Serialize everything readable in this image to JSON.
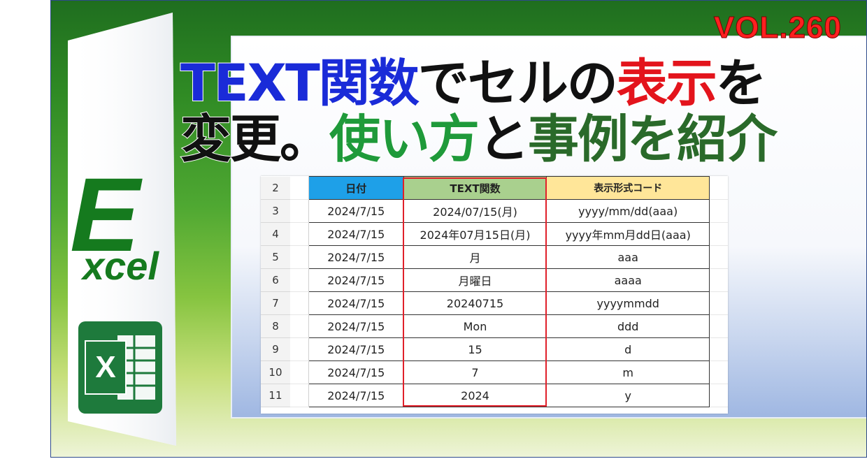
{
  "volume": "VOL.260",
  "title": {
    "line1": [
      {
        "text": "TEXT関数",
        "color": "blue"
      },
      {
        "text": "でセルの",
        "color": "black"
      },
      {
        "text": "表示",
        "color": "red"
      },
      {
        "text": "を",
        "color": "black"
      }
    ],
    "line2": [
      {
        "text": "変更。",
        "color": "black"
      },
      {
        "text": "使い方",
        "color": "green"
      },
      {
        "text": "と",
        "color": "black"
      },
      {
        "text": "事例を紹介",
        "color": "dgreen"
      }
    ]
  },
  "logo": {
    "big_letter": "E",
    "rest": "xcel",
    "icon_letter": "X"
  },
  "sheet": {
    "header": {
      "row": "2",
      "date": "日付",
      "text_func": "TEXT関数",
      "format": "表示形式コード"
    },
    "rows": [
      {
        "row": "3",
        "date": "2024/7/15",
        "text_func": "2024/07/15(月)",
        "format": "yyyy/mm/dd(aaa)"
      },
      {
        "row": "4",
        "date": "2024/7/15",
        "text_func": "2024年07月15日(月)",
        "format": "yyyy年mm月dd日(aaa)"
      },
      {
        "row": "5",
        "date": "2024/7/15",
        "text_func": "月",
        "format": "aaa"
      },
      {
        "row": "6",
        "date": "2024/7/15",
        "text_func": "月曜日",
        "format": "aaaa"
      },
      {
        "row": "7",
        "date": "2024/7/15",
        "text_func": "20240715",
        "format": "yyyymmdd"
      },
      {
        "row": "8",
        "date": "2024/7/15",
        "text_func": "Mon",
        "format": "ddd"
      },
      {
        "row": "9",
        "date": "2024/7/15",
        "text_func": "15",
        "format": "d"
      },
      {
        "row": "10",
        "date": "2024/7/15",
        "text_func": "7",
        "format": "m"
      },
      {
        "row": "11",
        "date": "2024/7/15",
        "text_func": "2024",
        "format": "y"
      }
    ]
  }
}
